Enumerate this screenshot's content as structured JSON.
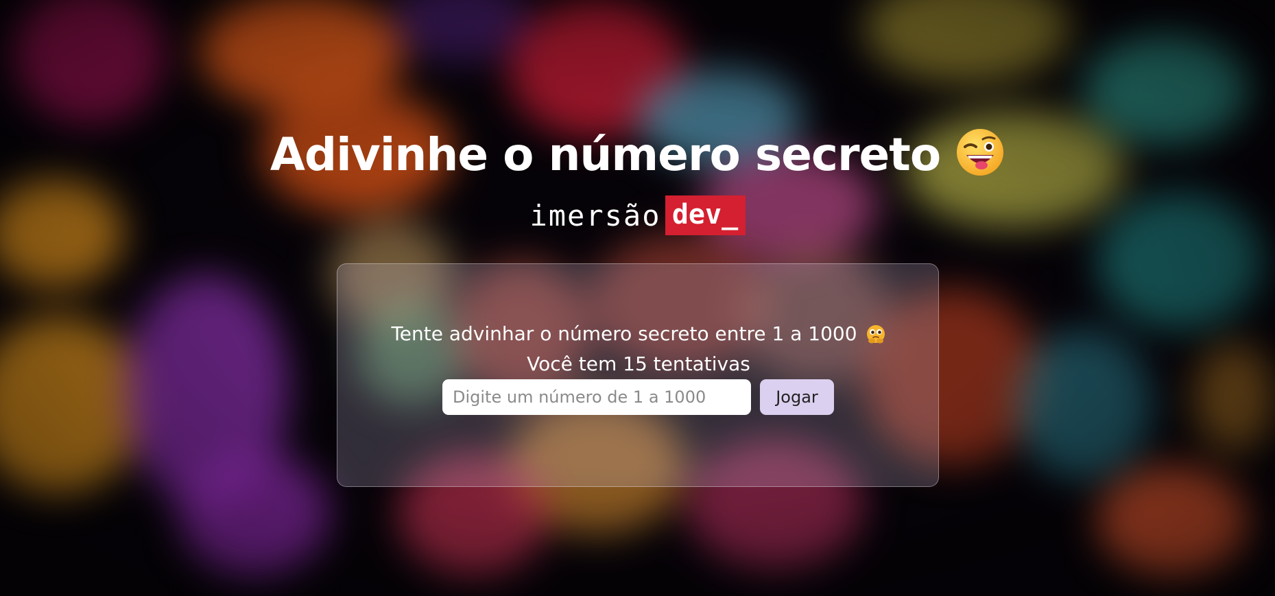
{
  "header": {
    "title": "Adivinhe o número secreto",
    "title_emoji": "winking-face-with-tongue-icon"
  },
  "brand": {
    "word": "imersão",
    "highlight": "dev_",
    "highlight_color": "#d42030"
  },
  "game": {
    "prompt": "Tente advinhar o número secreto entre 1 a 1000",
    "prompt_emoji": "thinking-face-icon",
    "attempts_text": "Você tem 15 tentativas",
    "input_placeholder": "Digite um número de 1 a 1000",
    "input_value": "",
    "play_label": "Jogar"
  },
  "colors": {
    "card_background": "rgba(210, 200, 230, 0.22)",
    "button_background": "#dcd0f0",
    "text": "#ffffff"
  }
}
